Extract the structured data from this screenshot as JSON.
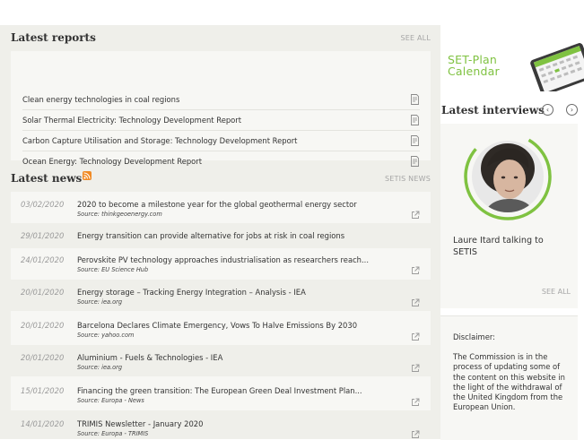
{
  "reports": {
    "title": "Latest reports",
    "see_all": "SEE ALL",
    "items": [
      "Clean energy technologies in coal regions",
      "Solar Thermal Electricity: Technology Development Report",
      "Carbon Capture Utilisation and Storage: Technology Development Report",
      "Ocean Energy: Technology Development Report"
    ]
  },
  "news": {
    "title": "Latest news",
    "link": "SETIS NEWS",
    "items": [
      {
        "date": "03/02/2020",
        "title": "2020 to become a milestone year for the global geothermal energy sector",
        "source": "Source: thinkgeoenergy.com"
      },
      {
        "date": "29/01/2020",
        "title": "Energy transition can provide alternative for jobs at risk in coal regions",
        "source": ""
      },
      {
        "date": "24/01/2020",
        "title": "Perovskite PV technology approaches industrialisation as researchers reach...",
        "source": "Source: EU Science Hub"
      },
      {
        "date": "20/01/2020",
        "title": "Energy storage – Tracking Energy Integration – Analysis - IEA",
        "source": "Source: iea.org"
      },
      {
        "date": "20/01/2020",
        "title": "Barcelona Declares Climate Emergency, Vows To Halve Emissions By 2030",
        "source": "Source: yahoo.com"
      },
      {
        "date": "20/01/2020",
        "title": "Aluminium - Fuels & Technologies - IEA",
        "source": "Source: iea.org"
      },
      {
        "date": "15/01/2020",
        "title": "Financing the green transition: The European Green Deal Investment Plan...",
        "source": "Source: Europa - News"
      },
      {
        "date": "14/01/2020",
        "title": "TRIMIS Newsletter - January 2020",
        "source": "Source: Europa - TRIMIS"
      }
    ]
  },
  "calendar": {
    "line1": "SET-Plan",
    "line2": "Calendar"
  },
  "interviews": {
    "title": "Latest interviews",
    "prev_icon": "chevron-left-icon",
    "next_icon": "chevron-right-icon",
    "person": "Laure Itard talking to SETIS",
    "see_all": "SEE ALL"
  },
  "disclaimer": {
    "title": "Disclaimer:",
    "text": "The Commission is in the process of updating some of the content on this website in the light of the withdrawal of the United Kingdom from the European Union."
  },
  "colors": {
    "accent_green": "#7fc241",
    "rss_orange": "#f08a24",
    "panel": "#efefea"
  }
}
